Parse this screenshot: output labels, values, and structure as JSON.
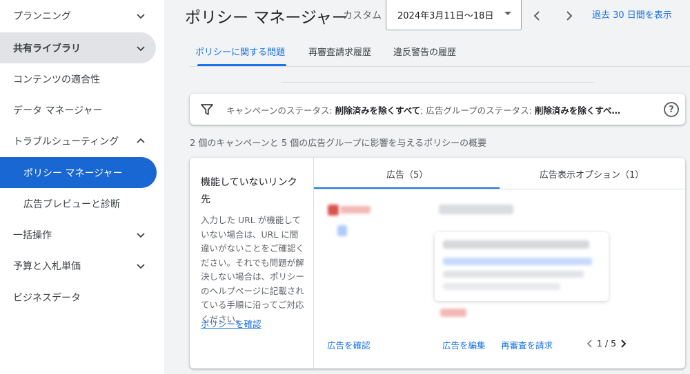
{
  "sidebar": {
    "items": [
      {
        "label": "プランニング",
        "chevron": "down"
      },
      {
        "label": "共有ライブラリ",
        "chevron": "down"
      },
      {
        "label": "コンテンツの適合性"
      },
      {
        "label": "データ マネージャー"
      },
      {
        "label": "トラブルシューティング",
        "chevron": "up"
      },
      {
        "label": "ポリシー マネージャー"
      },
      {
        "label": "広告プレビューと診断"
      },
      {
        "label": "一括操作",
        "chevron": "down"
      },
      {
        "label": "予算と入札単価",
        "chevron": "down"
      },
      {
        "label": "ビジネスデータ"
      }
    ]
  },
  "header": {
    "title": "ポリシー マネージャー",
    "custom_label": "カスタム",
    "date_range": "2024年3月11日〜18日",
    "past_30_days": "過去 30 日間を表示"
  },
  "tabs": [
    {
      "label": "ポリシーに関する問題",
      "active": true
    },
    {
      "label": "再審査請求履歴"
    },
    {
      "label": "違反警告の履歴"
    }
  ],
  "filter": {
    "campaign_status_label": "キャンペーンのステータス:",
    "campaign_status_value": "削除済みを除くすべて",
    "separator": ";",
    "adgroup_status_label": "広告グループのステータス:",
    "adgroup_status_value": "削除済みを除くすべ…"
  },
  "summary": "2 個のキャンペーンと 5 個の広告グループに影響を与えるポリシーの概要",
  "card": {
    "issue_title": "機能していないリンク先",
    "description": "入力した URL が機能していない場合は、URL に間違いがないことをご確認ください。それでも問題が解決しない場合は、ポリシーのヘルプページに記載されている手順に沿ってご対応ください。",
    "policy_link": "ポリシーを確認",
    "tabs": [
      {
        "label": "広告（5）",
        "active": true
      },
      {
        "label": "広告表示オプション（1）"
      }
    ],
    "actions": {
      "view_ad": "広告を確認",
      "edit_ad": "広告を編集",
      "request_review": "再審査を請求"
    },
    "pager": "1 / 5"
  },
  "colors": {
    "accent": "#1a73e8",
    "active_nav": "#1967d2",
    "open_group": "#e1e3e6"
  }
}
